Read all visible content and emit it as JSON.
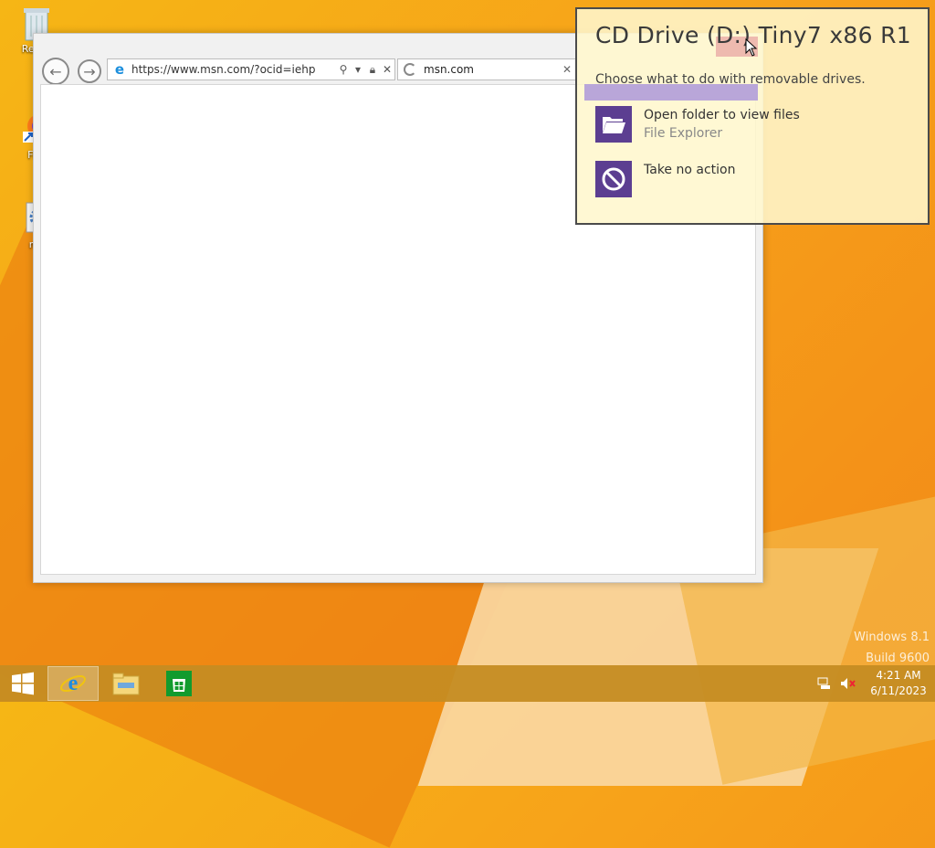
{
  "desktop": {
    "icons": [
      {
        "label": "Recyc",
        "icon": "recycle-bin-icon"
      },
      {
        "label": "Fire",
        "icon": "firefox-icon"
      },
      {
        "label": "ms",
        "icon": "setup-icon"
      }
    ],
    "watermark": {
      "line1": "Windows 8.1",
      "line2": "Build 9600"
    }
  },
  "browser": {
    "url": "https://www.msn.com/?ocid=iehp",
    "tab_title": "msn.com",
    "icons": {
      "back": "back-arrow-icon",
      "forward": "forward-arrow-icon",
      "search": "search-icon",
      "lock": "lock-icon",
      "stop": "close-icon"
    }
  },
  "autoplay": {
    "title": "CD Drive (D:) Tiny7 x86 R1",
    "subtitle": "Choose what to do with removable drives.",
    "options": [
      {
        "label": "Open folder to view files",
        "sublabel": "File Explorer",
        "icon": "folder-open-icon"
      },
      {
        "label": "Take no action",
        "sublabel": "",
        "icon": "no-action-icon"
      }
    ],
    "accent_color": "#5c3e91",
    "background_color": "#fff7cd"
  },
  "taskbar": {
    "items": [
      {
        "name": "internet-explorer",
        "icon": "internet-explorer-icon",
        "active": true
      },
      {
        "name": "file-explorer",
        "icon": "file-explorer-icon",
        "active": false
      },
      {
        "name": "store",
        "icon": "store-icon",
        "active": false
      }
    ],
    "tray": {
      "network": "network-icon",
      "volume": "volume-muted-icon"
    },
    "clock": {
      "time": "4:21 AM",
      "date": "6/11/2023"
    }
  }
}
